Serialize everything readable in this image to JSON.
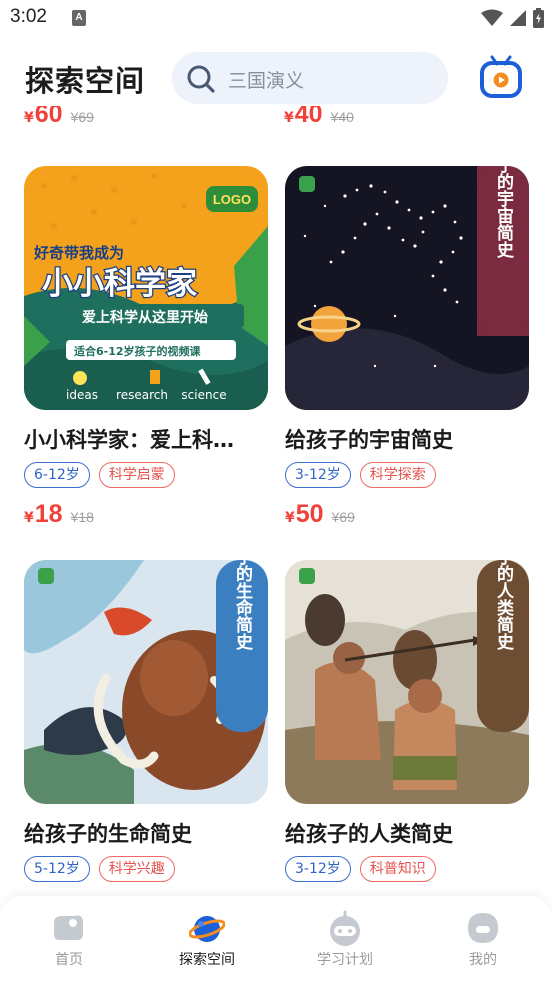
{
  "status_bar": {
    "time": "3:02",
    "a_icon": "A"
  },
  "header": {
    "title": "探索空间",
    "search_placeholder": "三国演义",
    "tv_icon": "tv-play-icon"
  },
  "top_prices": [
    {
      "yen": "¥",
      "price": "60",
      "old": "¥69"
    },
    {
      "yen": "¥",
      "price": "40",
      "old": "¥40"
    }
  ],
  "cards": [
    {
      "title": "小小科学家：爱上科…",
      "age": "6-12岁",
      "category": "科学启蒙",
      "yen": "¥",
      "price": "18",
      "old_price": "¥18",
      "cover": {
        "line1": "好奇带我成为",
        "big": "小小科学家",
        "banner": "爱上科学从这里开始",
        "sub": "适合6-12岁孩子的视频课",
        "words": [
          "ideas",
          "research",
          "science"
        ]
      }
    },
    {
      "title": "给孩子的宇宙简史",
      "age": "3-12岁",
      "category": "科学探索",
      "yen": "¥",
      "price": "50",
      "old_price": "¥69",
      "cover": {
        "vertical": "给孩子的宇宙简史"
      }
    },
    {
      "title": "给孩子的生命简史",
      "age": "5-12岁",
      "category": "科学兴趣",
      "cover": {
        "vertical": "给孩子的生命简史"
      }
    },
    {
      "title": "给孩子的人类简史",
      "age": "3-12岁",
      "category": "科普知识",
      "cover": {
        "vertical": "给孩子的人类简史"
      }
    }
  ],
  "bottom_nav": [
    {
      "label": "首页",
      "icon": "home-icon",
      "active": false
    },
    {
      "label": "探索空间",
      "icon": "planet-icon",
      "active": true
    },
    {
      "label": "学习计划",
      "icon": "robot-icon",
      "active": false
    },
    {
      "label": "我的",
      "icon": "profile-icon",
      "active": false
    }
  ],
  "colors": {
    "price": "#f0413b",
    "age_tag": "#2f64c8",
    "category_tag": "#e4544f",
    "brand_blue": "#1d5fd8"
  }
}
